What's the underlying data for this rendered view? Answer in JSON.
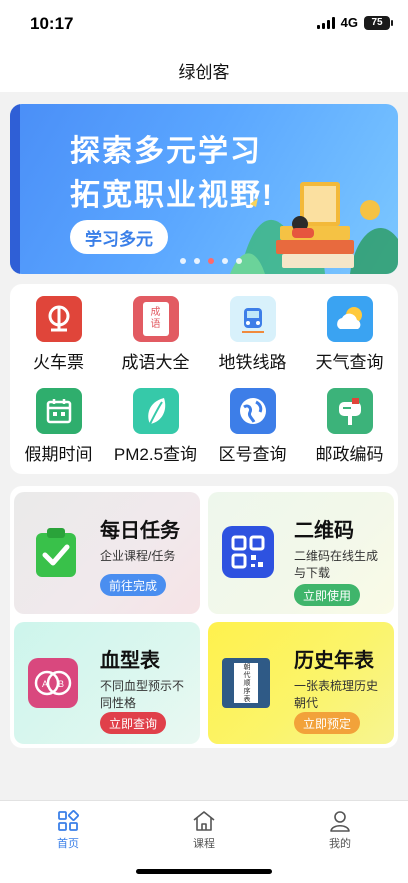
{
  "status": {
    "time": "10:17",
    "network": "4G",
    "battery": "75"
  },
  "header": {
    "title": "绿创客"
  },
  "banner": {
    "line1": "探索多元学习",
    "line2": "拓宽职业视野!",
    "button": "学习多元"
  },
  "grid": [
    {
      "label": "火车票",
      "icon": "train-ticket-icon",
      "color": "#e0453a"
    },
    {
      "label": "成语大全",
      "icon": "idiom-book-icon",
      "color": "#e25b62",
      "icon_text": [
        "成",
        "语"
      ]
    },
    {
      "label": "地铁线路",
      "icon": "subway-icon",
      "color": "#bfe7f8"
    },
    {
      "label": "天气查询",
      "icon": "weather-icon",
      "color": "#3aa3f2"
    },
    {
      "label": "假期时间",
      "icon": "calendar-icon",
      "color": "#2fae6d"
    },
    {
      "label": "PM2.5查询",
      "icon": "leaf-icon",
      "color": "#36c9a9"
    },
    {
      "label": "区号查询",
      "icon": "globe-icon",
      "color": "#3d7ee8"
    },
    {
      "label": "邮政编码",
      "icon": "mailbox-icon",
      "color": "#3cb37a"
    }
  ],
  "features": [
    {
      "title": "每日任务",
      "desc": "企业课程/任务",
      "button": "前往完成",
      "button_color": "#4a8ef0",
      "icon": "clipboard-check-icon"
    },
    {
      "title": "二维码",
      "desc": "二维码在线生成与下载",
      "button": "立即使用",
      "button_color": "#3fb56b",
      "icon": "qrcode-icon"
    },
    {
      "title": "血型表",
      "desc": "不同血型预示不同性格",
      "button": "立即查询",
      "button_color": "#e0404a",
      "icon": "blood-type-icon",
      "icon_text": [
        "A",
        "B"
      ]
    },
    {
      "title": "历史年表",
      "desc": "一张表梳理历史朝代",
      "button": "立即预定",
      "button_color": "#f2a23a",
      "icon": "history-book-icon",
      "icon_text": "朝代顺序表"
    }
  ],
  "tabs": [
    {
      "label": "首页",
      "icon": "home-grid-icon",
      "active": true
    },
    {
      "label": "课程",
      "icon": "house-icon",
      "active": false
    },
    {
      "label": "我的",
      "icon": "person-icon",
      "active": false
    }
  ],
  "colors": {
    "accent": "#3a7fe8",
    "banner": "#5aa6ff"
  }
}
